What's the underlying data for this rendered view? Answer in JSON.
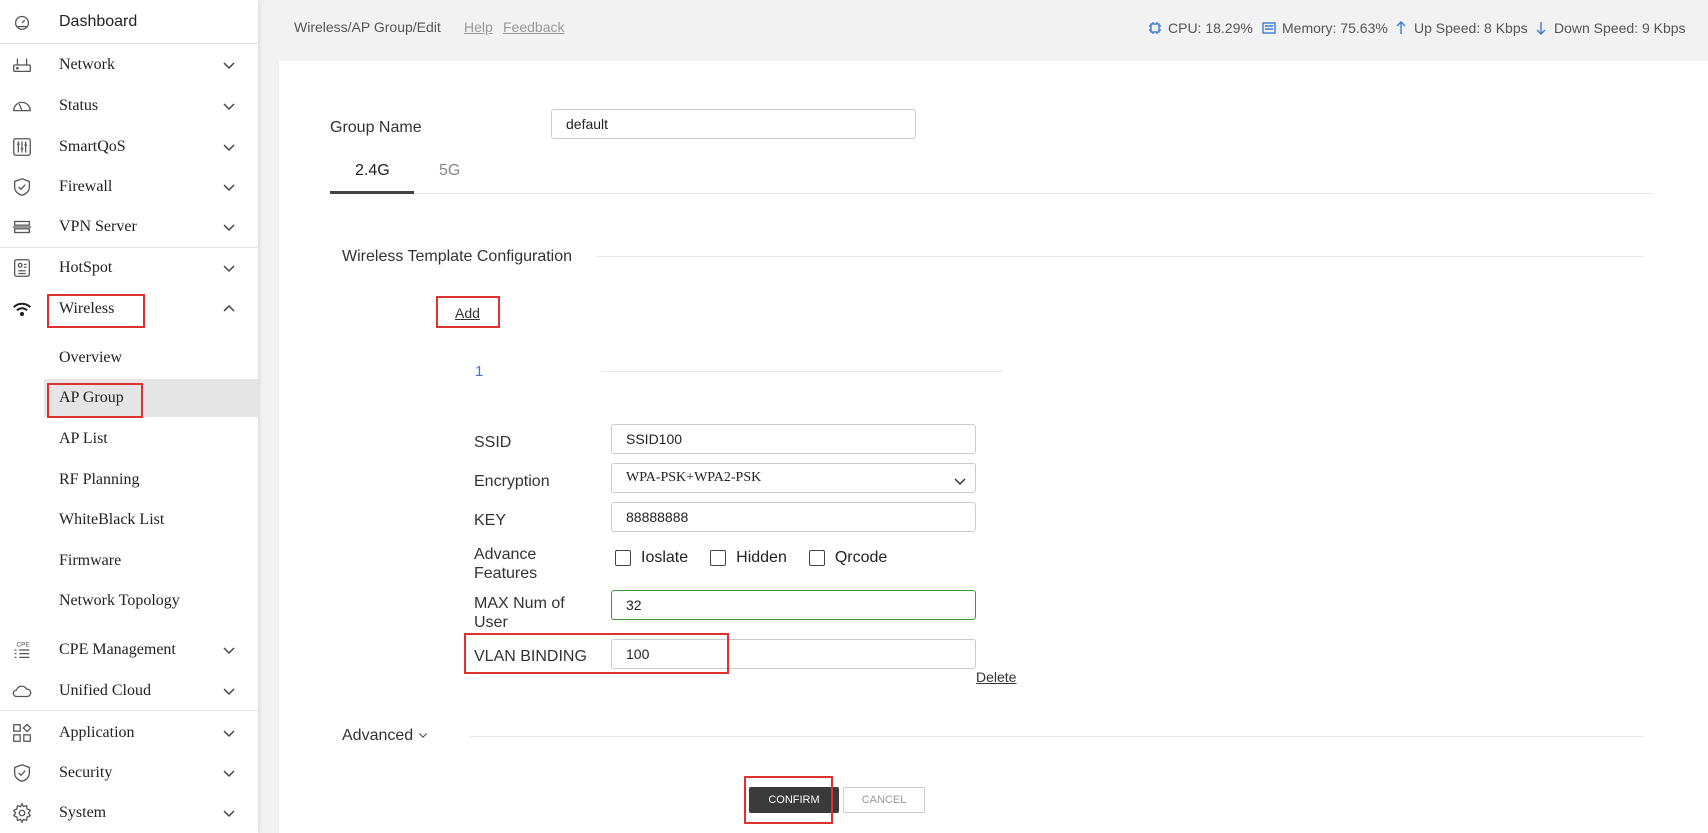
{
  "sidebar": {
    "dashboard": "Dashboard",
    "items": [
      {
        "label": "Network",
        "icon": "router-icon"
      },
      {
        "label": "Status",
        "icon": "gauge-icon"
      },
      {
        "label": "SmartQoS",
        "icon": "sliders-icon"
      },
      {
        "label": "Firewall",
        "icon": "shield-icon"
      },
      {
        "label": "VPN Server",
        "icon": "server-icon"
      },
      {
        "label": "HotSpot",
        "icon": "hotspot-icon"
      },
      {
        "label": "Wireless",
        "icon": "wifi-icon"
      },
      {
        "label": "CPE Management",
        "icon": "cpe-icon"
      },
      {
        "label": "Unified Cloud",
        "icon": "cloud-icon"
      },
      {
        "label": "Application",
        "icon": "apps-icon"
      },
      {
        "label": "Security",
        "icon": "security-shield-icon"
      },
      {
        "label": "System",
        "icon": "gear-icon"
      }
    ],
    "wireless_sub": [
      "Overview",
      "AP Group",
      "AP List",
      "RF Planning",
      "WhiteBlack List",
      "Firmware",
      "Network Topology"
    ]
  },
  "topbar": {
    "breadcrumb": "Wireless/AP Group/Edit",
    "help": "Help",
    "feedback": "Feedback",
    "cpu": "CPU: 18.29%",
    "memory": "Memory: 75.63%",
    "up": "Up Speed: 8 Kbps",
    "down": "Down Speed: 9 Kbps"
  },
  "form": {
    "group_name_label": "Group Name",
    "group_name_value": "default",
    "tabs": [
      "2.4G",
      "5G"
    ],
    "section_title": "Wireless Template Configuration",
    "add": "Add",
    "template_index": "1",
    "ssid_label": "SSID",
    "ssid_value": "SSID100",
    "encryption_label": "Encryption",
    "encryption_value": "WPA-PSK+WPA2-PSK",
    "key_label": "KEY",
    "key_value": "88888888",
    "advance_label_1": "Advance",
    "advance_label_2": "Features",
    "features": [
      "Ioslate",
      "Hidden",
      "Qrcode"
    ],
    "max_user_label_1": "MAX Num of",
    "max_user_label_2": "User",
    "max_user_value": "32",
    "vlan_label": "VLAN BINDING",
    "vlan_value": "100",
    "delete": "Delete",
    "advanced": "Advanced",
    "confirm": "CONFIRM",
    "cancel": "CANCEL"
  },
  "colors": {
    "highlight": "#e03131",
    "accent_blue": "#3a7bd5",
    "primary_button": "#3a3a3a",
    "active_input_border": "#3a9a3a"
  }
}
